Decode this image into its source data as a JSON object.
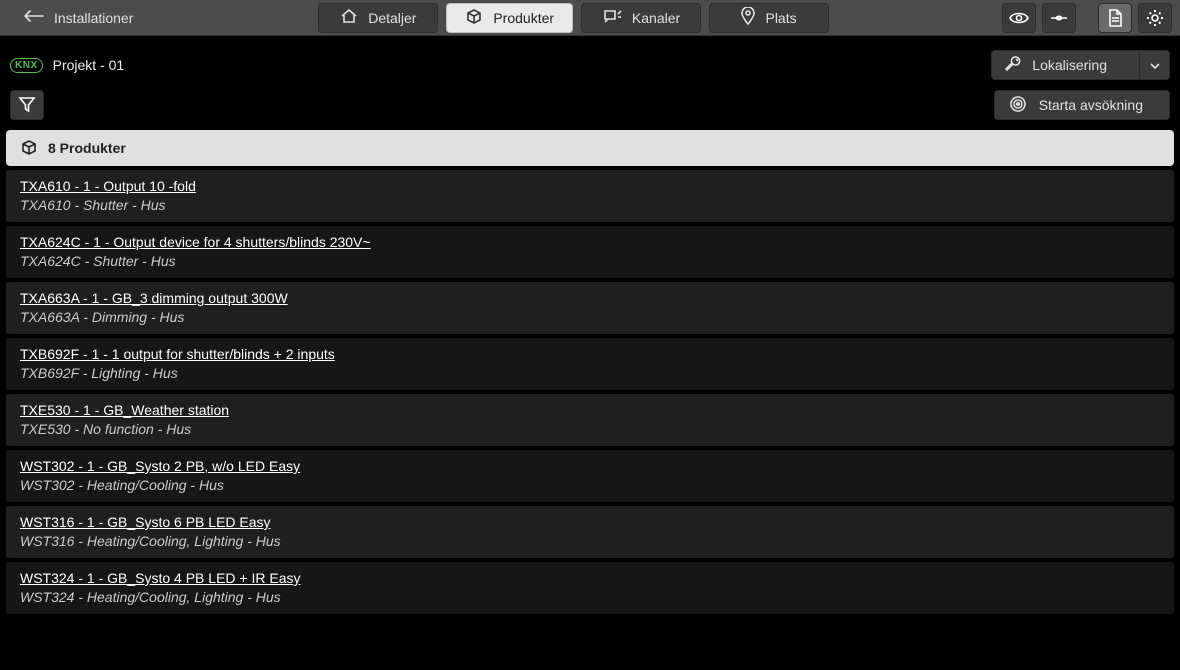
{
  "topbar": {
    "back_label": "Installationer",
    "tabs": {
      "details": "Detaljer",
      "products": "Produkter",
      "channels": "Kanaler",
      "location": "Plats"
    }
  },
  "project": {
    "badge": "KNX",
    "title": "Projekt - 01",
    "localize_label": "Lokalisering"
  },
  "actions": {
    "scan_label": "Starta avsökning"
  },
  "list": {
    "header": "8 Produkter",
    "items": [
      {
        "title": "TXA610 - 1 - Output 10 -fold",
        "sub": "TXA610 - Shutter - Hus"
      },
      {
        "title": "TXA624C - 1 - Output device for 4 shutters/blinds 230V~",
        "sub": "TXA624C - Shutter - Hus"
      },
      {
        "title": "TXA663A - 1 - GB_3 dimming output 300W",
        "sub": "TXA663A - Dimming - Hus"
      },
      {
        "title": "TXB692F - 1 - 1 output for shutter/blinds + 2 inputs",
        "sub": "TXB692F - Lighting - Hus"
      },
      {
        "title": "TXE530 - 1 - GB_Weather station",
        "sub": "TXE530 - No function - Hus"
      },
      {
        "title": "WST302 - 1 - GB_Systo 2 PB, w/o LED Easy",
        "sub": "WST302 - Heating/Cooling - Hus"
      },
      {
        "title": "WST316 - 1 - GB_Systo 6 PB LED Easy",
        "sub": "WST316 - Heating/Cooling, Lighting - Hus"
      },
      {
        "title": "WST324 - 1 - GB_Systo 4 PB LED + IR Easy",
        "sub": "WST324 - Heating/Cooling, Lighting - Hus"
      }
    ]
  }
}
